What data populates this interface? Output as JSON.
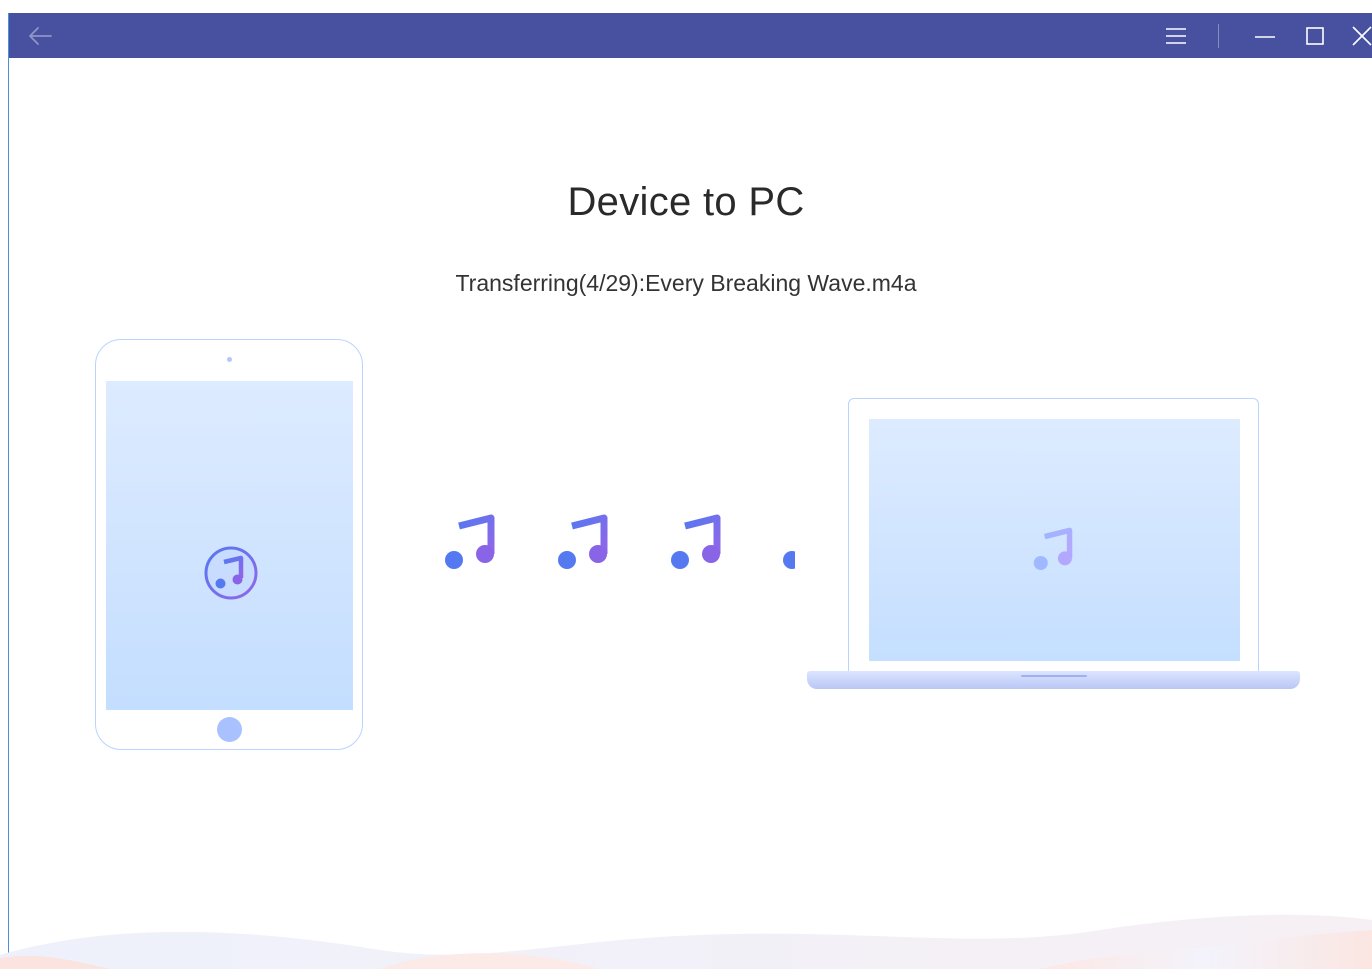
{
  "titlebar": {
    "background": "#47519f",
    "back_icon": "arrow-left-icon",
    "menu_icon": "hamburger-menu-icon",
    "minimize_icon": "minimize-icon",
    "maximize_icon": "maximize-icon",
    "close_icon": "close-icon"
  },
  "main": {
    "title": "Device to PC",
    "status": "Transferring(4/29):Every Breaking Wave.m4a"
  },
  "progress": {
    "current": 4,
    "total": 29,
    "file": "Every Breaking Wave.m4a"
  },
  "illustration": {
    "source_device": "tablet",
    "target_device": "laptop",
    "item_icon": "music-note-icon",
    "accent_blue": "#4a6ee8",
    "accent_purple": "#8a64e6",
    "device_outline": "#bcd2ff"
  }
}
